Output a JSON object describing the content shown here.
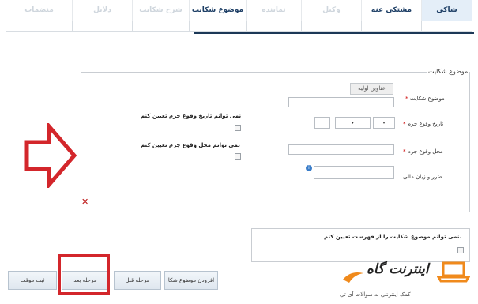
{
  "tabs": [
    {
      "label": "شاکی"
    },
    {
      "label": "مشتکی عنه"
    },
    {
      "label": "وکیل"
    },
    {
      "label": "نماینده"
    },
    {
      "label": "موضوع شکایت"
    },
    {
      "label": "شرح شکایت"
    },
    {
      "label": "دلایل"
    },
    {
      "label": "منضمات"
    }
  ],
  "form": {
    "legend": "موضوع شکایت",
    "subject_label": "موضوع شکایت",
    "subject_button": "عناوین اولیه",
    "crime_date_label": "تاریخ وقوع جرم",
    "crime_date_day": "",
    "crime_date_month": "▾",
    "crime_date_year": "▾",
    "crime_place_label": "محل وقوع جرم",
    "loss_label": "ضرر و زیان مالی",
    "cannot_date": "نمی توانم تاریخ وقوع جرم تعیین کنم",
    "cannot_place": "نمی توانم محل وقوع جرم تعیین کنم",
    "close_label": "✕",
    "cannot_subject": "نمی توانم موضوع شکایت را از فهرست تعیین کنم."
  },
  "buttons": {
    "add_subject": "افزودن موضوع شکا",
    "prev_step": "مرحله قبل",
    "next_step": "مرحله بعد",
    "submit": "ثبت موقت"
  },
  "logo": {
    "title": "اینترنت گاه",
    "subtitle": "کمک اینترنتی به سوالات آی تی"
  },
  "colors": {
    "arrow": "#d3262b",
    "highlight": "#d3262b",
    "active_tab_bg": "#e4eef8"
  }
}
